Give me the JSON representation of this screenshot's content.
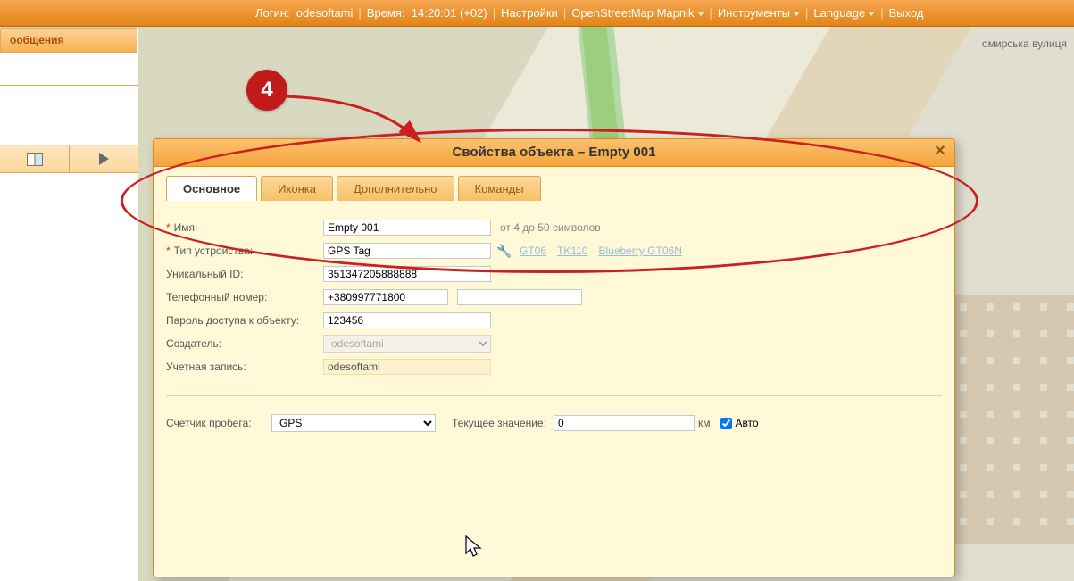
{
  "topbar": {
    "login_label": "Логин:",
    "login_user": "odesoftami",
    "time_label": "Время:",
    "time_value": "14:20:01 (+02)",
    "settings": "Настройки",
    "basemap": "OpenStreetMap Mapnik",
    "tools": "Инструменты",
    "language": "Language",
    "logout": "Выход"
  },
  "sidebar": {
    "messages_tab": "ообщения"
  },
  "annotation": {
    "step": "4"
  },
  "dialog": {
    "title": "Свойства объекта – Empty 001",
    "tabs": {
      "main": "Основное",
      "icon": "Иконка",
      "extra": "Дополнительно",
      "commands": "Команды"
    },
    "form": {
      "name_label": "Имя:",
      "name_value": "Empty 001",
      "name_hint": "от 4 до 50 символов",
      "device_type_label": "Тип устройства:",
      "device_type_value": "GPS Tag",
      "device_presets": [
        "GT06",
        "TK110",
        "Blueberry GT06N"
      ],
      "uid_label": "Уникальный ID:",
      "uid_value": "351347205888888",
      "phone_label": "Телефонный номер:",
      "phone_value": "+380997771800",
      "phone2_value": "",
      "password_label": "Пароль доступа к объекту:",
      "password_value": "123456",
      "creator_label": "Создатель:",
      "creator_value": "odesoftami",
      "account_label": "Учетная запись:",
      "account_value": "odesoftami"
    },
    "odometer": {
      "label": "Счетчик пробега:",
      "source_value": "GPS",
      "current_label": "Текущее значение:",
      "current_value": "0",
      "unit": "км",
      "auto_label": "Авто"
    }
  }
}
